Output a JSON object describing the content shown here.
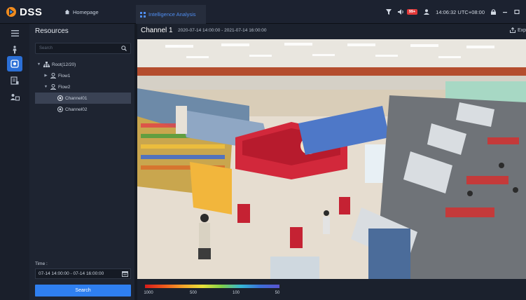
{
  "app": {
    "name": "DSS"
  },
  "tabs": {
    "home_label": "Homepage",
    "active_label": "Intelligence Analysis"
  },
  "system": {
    "alarm_badge": "99+",
    "time": "14:06:32 UTC+08:00"
  },
  "resources": {
    "title": "Resources",
    "search_placeholder": "Search",
    "tree": [
      {
        "label": "Root(12/20)",
        "level": 0,
        "expanded": true,
        "selected": false
      },
      {
        "label": "Flow1",
        "level": 1,
        "expanded": false,
        "selected": false
      },
      {
        "label": "Flow2",
        "level": 1,
        "expanded": true,
        "selected": false
      },
      {
        "label": "Channel01",
        "level": 2,
        "expanded": false,
        "selected": true
      },
      {
        "label": "Channel02",
        "level": 2,
        "expanded": false,
        "selected": false
      }
    ],
    "time_label": "Time :",
    "time_value": "07-14 14:00:00 - 07-14 16:00:00",
    "search_button": "Search"
  },
  "viewer": {
    "channel_title": "Channel 1",
    "range": "2020-07-14 14:00:00 - 2021-07-14 16:00:00",
    "export_label": "Exp",
    "legend_values": [
      "1000",
      "500",
      "100",
      "50"
    ]
  },
  "colors": {
    "accent": "#2f7ff0",
    "badge": "#e33a3a"
  }
}
